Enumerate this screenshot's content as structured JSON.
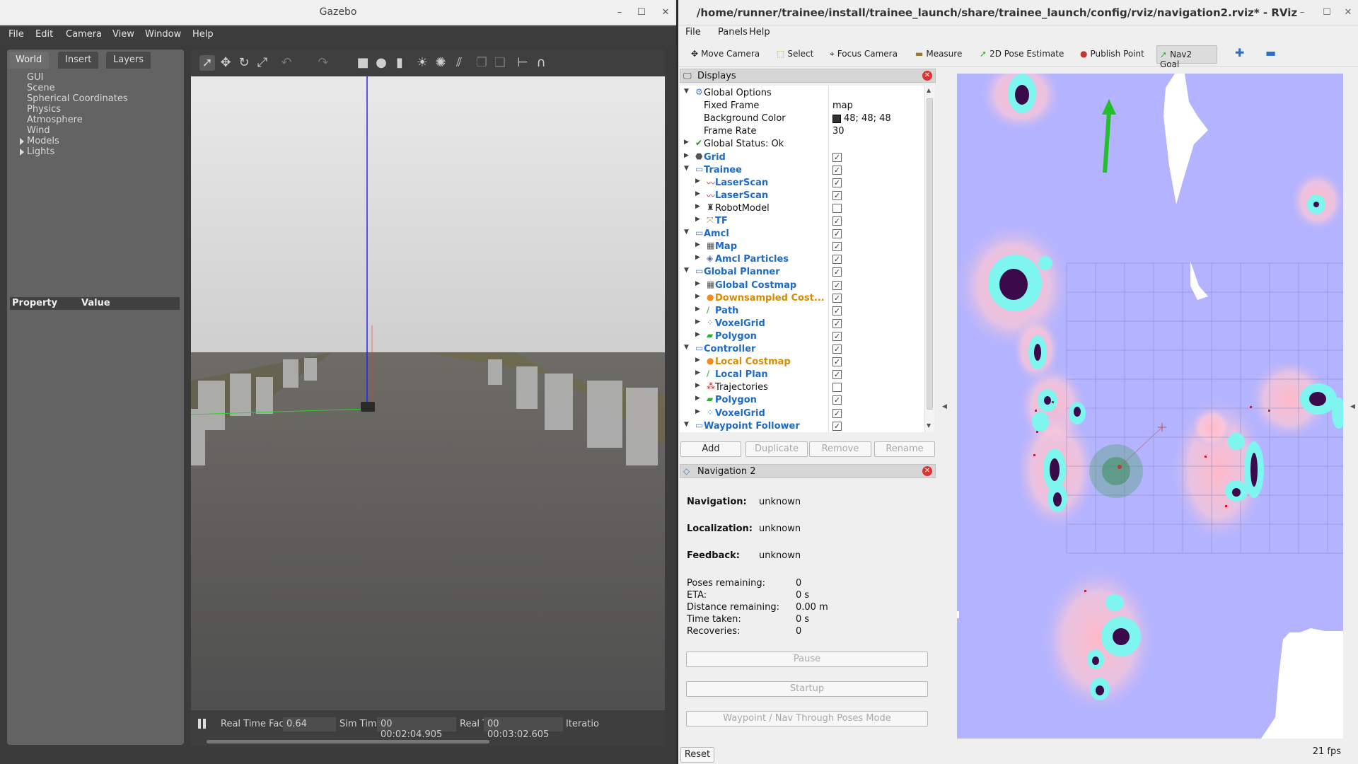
{
  "gazebo": {
    "title": "Gazebo",
    "menu": [
      "File",
      "Edit",
      "Camera",
      "View",
      "Window",
      "Help"
    ],
    "tabs": [
      "World",
      "Insert",
      "Layers"
    ],
    "tree": [
      "GUI",
      "Scene",
      "Spherical Coordinates",
      "Physics",
      "Atmosphere",
      "Wind",
      "Models",
      "Lights"
    ],
    "property_header": {
      "property": "Property",
      "value": "Value"
    },
    "status": {
      "real_time_factor_label": "Real Time Factor:",
      "real_time_factor": "0.64",
      "sim_time_label": "Sim Time:",
      "sim_time": "00 00:02:04.905",
      "real_time_label": "Real Time:",
      "real_time": "00 00:03:02.605",
      "iterations_label": "Iteratio"
    }
  },
  "rviz": {
    "title": "/home/runner/trainee/install/trainee_launch/share/trainee_launch/config/rviz/navigation2.rviz* - RViz",
    "menu": [
      "File",
      "Panels",
      "Help"
    ],
    "tools": [
      "Move Camera",
      "Select",
      "Focus Camera",
      "Measure",
      "2D Pose Estimate",
      "Publish Point",
      "Nav2 Goal"
    ],
    "displays": {
      "title": "Displays",
      "rows": [
        {
          "name": "Global Options",
          "value": ""
        },
        {
          "name": "Fixed Frame",
          "value": "map"
        },
        {
          "name": "Background Color",
          "value": "48; 48; 48"
        },
        {
          "name": "Frame Rate",
          "value": "30"
        },
        {
          "name": "Global Status: Ok",
          "value": ""
        },
        {
          "name": "Grid",
          "value": "true"
        },
        {
          "name": "Trainee",
          "value": "true"
        },
        {
          "name": "LaserScan",
          "value": "true"
        },
        {
          "name": "LaserScan",
          "value": "true"
        },
        {
          "name": "RobotModel",
          "value": "false"
        },
        {
          "name": "TF",
          "value": "true"
        },
        {
          "name": "Amcl",
          "value": "true"
        },
        {
          "name": "Map",
          "value": "true"
        },
        {
          "name": "Amcl Particles",
          "value": "true"
        },
        {
          "name": "Global Planner",
          "value": "true"
        },
        {
          "name": "Global Costmap",
          "value": "true"
        },
        {
          "name": "Downsampled Cost...",
          "value": "true"
        },
        {
          "name": "Path",
          "value": "true"
        },
        {
          "name": "VoxelGrid",
          "value": "true"
        },
        {
          "name": "Polygon",
          "value": "true"
        },
        {
          "name": "Controller",
          "value": "true"
        },
        {
          "name": "Local Costmap",
          "value": "true"
        },
        {
          "name": "Local Plan",
          "value": "true"
        },
        {
          "name": "Trajectories",
          "value": "false"
        },
        {
          "name": "Polygon",
          "value": "true"
        },
        {
          "name": "VoxelGrid",
          "value": "true"
        },
        {
          "name": "Waypoint Follower",
          "value": "true"
        }
      ],
      "buttons": [
        "Add",
        "Duplicate",
        "Remove",
        "Rename"
      ]
    },
    "nav2": {
      "title": "Navigation 2",
      "navigation_label": "Navigation:",
      "navigation": "unknown",
      "localization_label": "Localization:",
      "localization": "unknown",
      "feedback_label": "Feedback:",
      "feedback": "unknown",
      "stats": [
        {
          "label": "Poses remaining:",
          "value": "0"
        },
        {
          "label": "ETA:",
          "value": "0 s"
        },
        {
          "label": "Distance remaining:",
          "value": "0.00 m"
        },
        {
          "label": "Time taken:",
          "value": "0 s"
        },
        {
          "label": "Recoveries:",
          "value": "0"
        }
      ],
      "buttons": [
        "Pause",
        "Startup",
        "Waypoint / Nav Through Poses Mode"
      ]
    },
    "reset": "Reset",
    "fps": "21 fps",
    "colors": {
      "background_swatch": "#303030",
      "costmap": "#b3b3ff",
      "inflation": "#7ff5f0",
      "obstacle": "#3a0a4a",
      "goal_arrow": "#22c02a"
    }
  }
}
